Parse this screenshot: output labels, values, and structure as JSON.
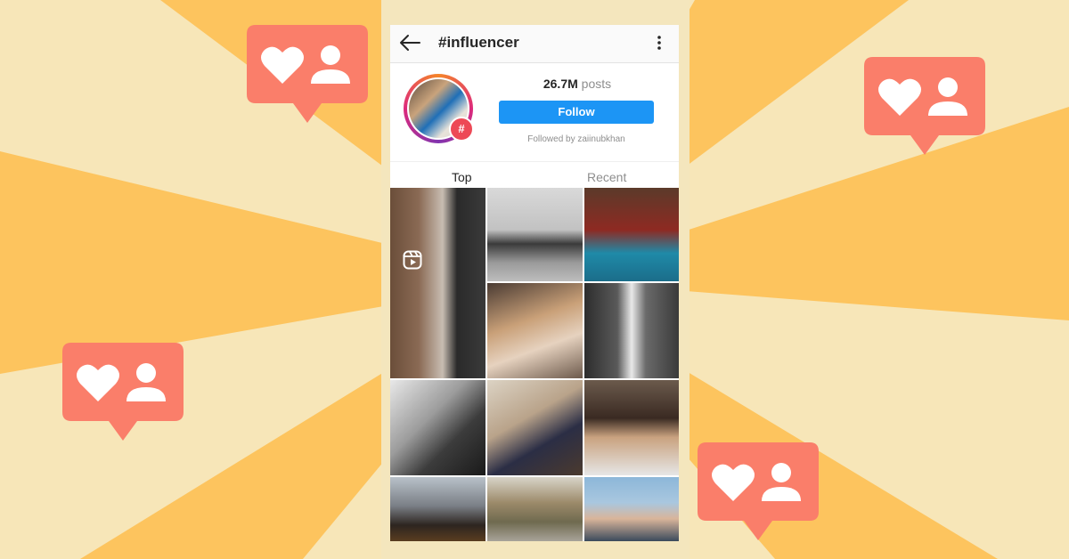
{
  "colors": {
    "background_light": "#f7e6b8",
    "background_ray": "#fdc45e",
    "badge": "#fa7e6a",
    "follow_button": "#1c95f5",
    "story_ring": "#dd2a7b"
  },
  "decorations": {
    "badge_icons": [
      "heart-icon",
      "person-icon"
    ]
  },
  "header": {
    "back_icon": "back-arrow-icon",
    "title": "#influencer",
    "more_icon": "more-vertical-icon"
  },
  "profile": {
    "posts_count": "26.7M",
    "posts_label": "posts",
    "follow_label": "Follow",
    "followed_by": "Followed by zaiinubkhan",
    "hashtag_badge": "#"
  },
  "tabs": [
    {
      "label": "Top",
      "selected": true
    },
    {
      "label": "Recent",
      "selected": false
    }
  ],
  "grid": {
    "reels_icon": "reels-icon",
    "photos": [
      {
        "name": "photo-man-street"
      },
      {
        "name": "photo-woman-leather-jacket"
      },
      {
        "name": "photo-woman-red-dress"
      },
      {
        "name": "photo-woman-phone"
      },
      {
        "name": "photo-man-white-outfit"
      },
      {
        "name": "photo-woman-car-eiffel"
      },
      {
        "name": "photo-woman-armchair"
      },
      {
        "name": "photo-woman-cafe"
      },
      {
        "name": "photo-night-jump"
      },
      {
        "name": "photo-woman-street"
      },
      {
        "name": "photo-man-portrait"
      }
    ]
  }
}
